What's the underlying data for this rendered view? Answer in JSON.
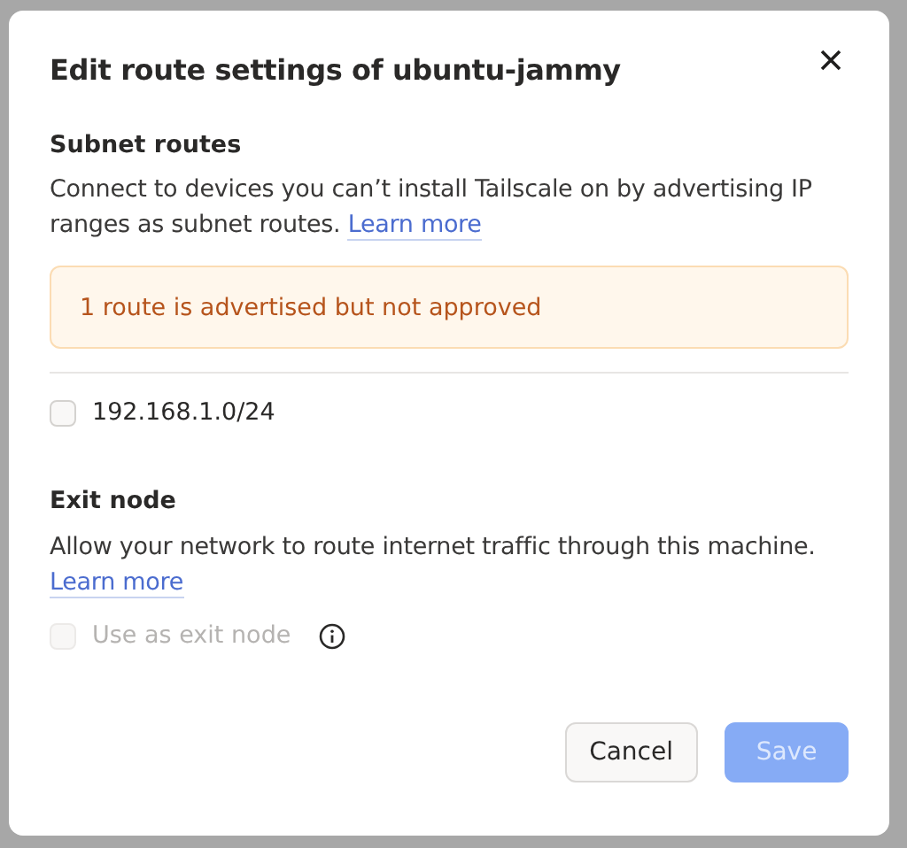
{
  "dialog": {
    "title": "Edit route settings of ubuntu-jammy"
  },
  "subnet_routes": {
    "heading": "Subnet routes",
    "description": "Connect to devices you can’t install Tailscale on by advertising IP ranges as subnet routes.",
    "link": "Learn more",
    "alert": "1 route is advertised but not approved",
    "routes": [
      {
        "label": "192.168.1.0/24",
        "checked": false,
        "disabled": false
      }
    ]
  },
  "exit_node": {
    "heading": "Exit node",
    "description": "Allow your network to route internet traffic through this machine.",
    "link": "Learn more",
    "option": {
      "label": "Use as exit node",
      "checked": false,
      "disabled": true
    }
  },
  "buttons": [
    {
      "label": "Cancel",
      "kind": "secondary",
      "disabled": false
    },
    {
      "label": "Save",
      "kind": "primary",
      "disabled": true
    }
  ]
}
